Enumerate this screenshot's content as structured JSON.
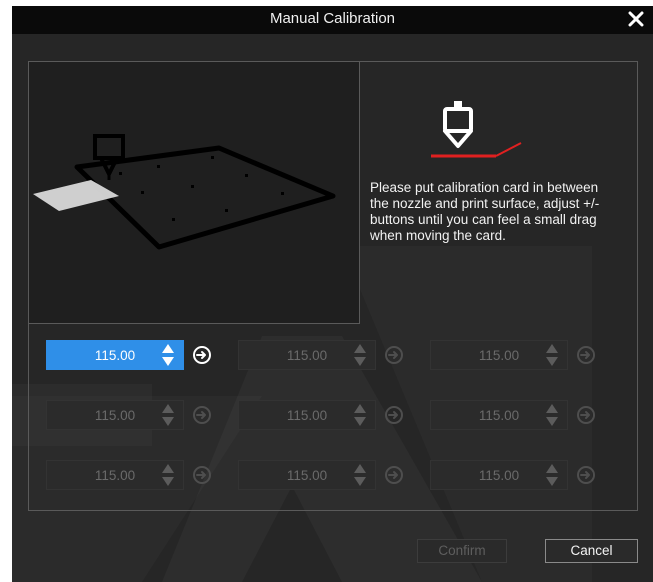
{
  "window": {
    "title": "Manual Calibration"
  },
  "instruction": "Please put calibration card in between the nozzle and print surface, adjust +/- buttons until you can feel a small drag when moving the card.",
  "cells": [
    {
      "value": "115.00",
      "active": true
    },
    {
      "value": "115.00",
      "active": false
    },
    {
      "value": "115.00",
      "active": false
    },
    {
      "value": "115.00",
      "active": false
    },
    {
      "value": "115.00",
      "active": false
    },
    {
      "value": "115.00",
      "active": false
    },
    {
      "value": "115.00",
      "active": false
    },
    {
      "value": "115.00",
      "active": false
    },
    {
      "value": "115.00",
      "active": false
    }
  ],
  "buttons": {
    "confirm": "Confirm",
    "cancel": "Cancel"
  },
  "colors": {
    "accent": "#2f8fe8",
    "background": "#262626",
    "titlebar": "#0a0a0a",
    "card_line": "#e02020"
  },
  "icons": {
    "close": "close-icon",
    "spinner": "up-down-arrows-icon",
    "apply": "circle-arrow-right-icon",
    "nozzle": "nozzle-icon"
  }
}
